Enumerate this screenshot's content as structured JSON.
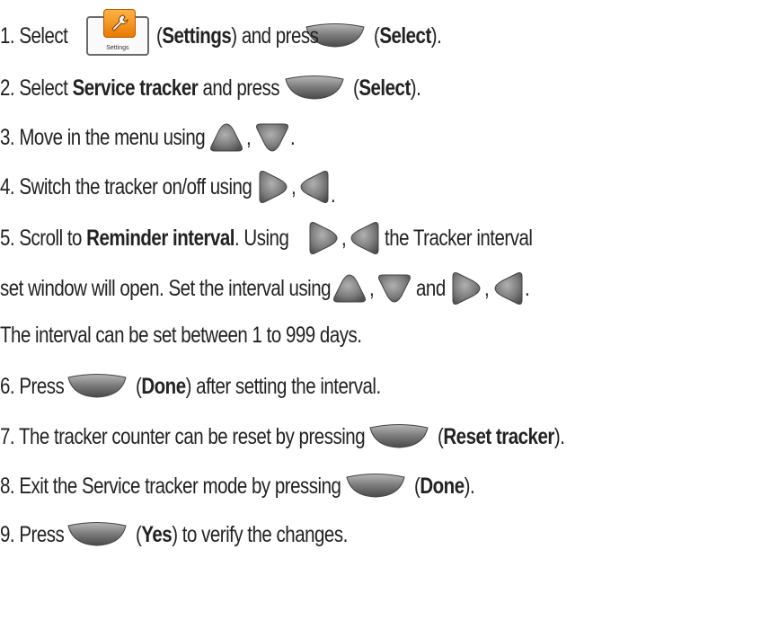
{
  "steps": [
    {
      "num": "1.",
      "t1": "Select",
      "settings_caption": "Settings",
      "t2": "(",
      "bold1": "Settings",
      "t3": ") and press",
      "t4": "(",
      "bold2": "Select",
      "t5": ")."
    },
    {
      "num": "2.",
      "t1": "Select",
      "bold1": "Service tracker",
      "t2": "and press",
      "t3": "(",
      "bold2": "Select",
      "t4": ")."
    },
    {
      "num": "3.",
      "t1": "Move in the menu using",
      "comma": ",",
      "t2": "."
    },
    {
      "num": "4.",
      "t1": "Switch the tracker on/off using",
      "comma": ",",
      "t2": "."
    },
    {
      "num": "5.",
      "t1": "Scroll to",
      "bold1": "Reminder interval",
      "t2": ". Using",
      "comma": ",",
      "t3": "the Tracker interval"
    },
    {
      "t1": "set window will open. Set the interval using",
      "comma1": ",",
      "and": "and",
      "comma2": ",",
      "t2": "."
    },
    {
      "t1": "The interval can be set between 1 to 999 days."
    },
    {
      "num": "6.",
      "t1": "Press",
      "t2": "(",
      "bold1": "Done",
      "t3": ") after setting the interval."
    },
    {
      "num": "7.",
      "t1": "The tracker counter can be reset by pressing",
      "t2": "(",
      "bold1": "Reset tracker",
      "t3": ")."
    },
    {
      "num": "8.",
      "t1": "Exit the Service tracker mode by pressing",
      "t2": "(",
      "bold1": "Done",
      "t3": ")."
    },
    {
      "num": "9.",
      "t1": "Press",
      "t2": "(",
      "bold1": "Yes",
      "t3": ") to verify the changes."
    }
  ],
  "icons": {
    "settings": "settings-wrench-icon",
    "select": "select-button-icon",
    "up": "up-arrow-button-icon",
    "down": "down-arrow-button-icon",
    "right": "right-arrow-button-icon",
    "left": "left-arrow-button-icon"
  },
  "colors": {
    "text": "#222222",
    "button_gray": "#7d7d7d",
    "settings_orange": "#f08c1a"
  }
}
